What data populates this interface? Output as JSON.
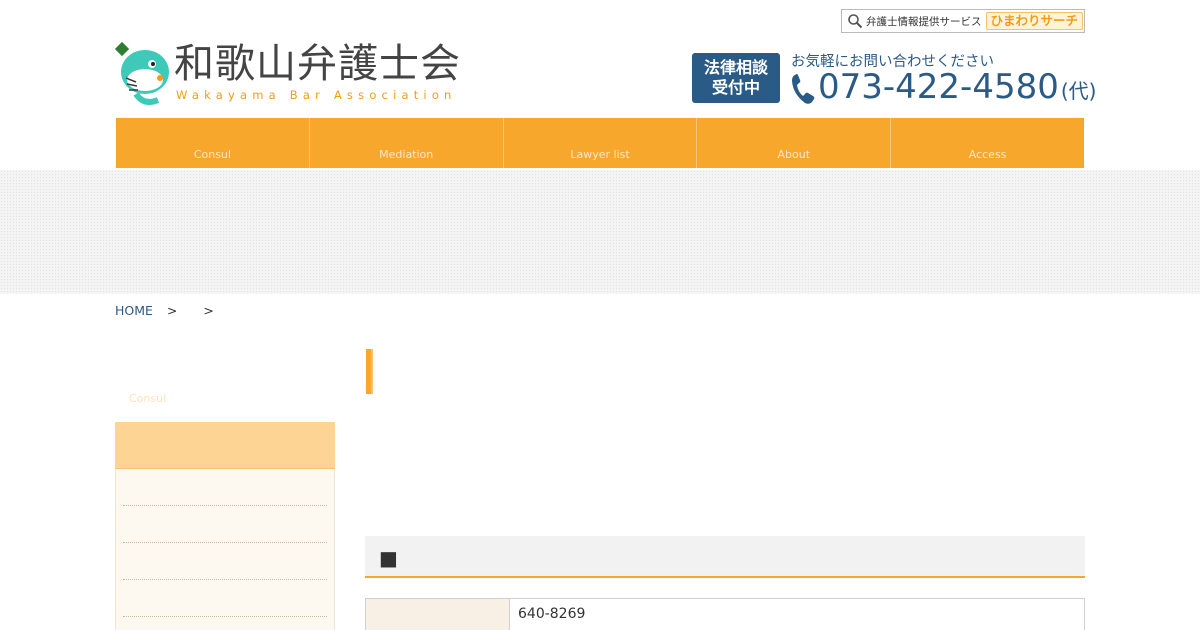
{
  "header": {
    "logo_jp": "和歌山弁護士会",
    "logo_en": "Wakayama Bar Association",
    "service_label": "弁護士情報提供サービス",
    "service_brand": "ひまわりサーチ",
    "consult_badge_line1": "法律相談",
    "consult_badge_line2": "受付中",
    "phone_lead": "お気軽にお問い合わせください",
    "phone_number": "073-422-4580",
    "phone_suffix": "(代)"
  },
  "nav": {
    "items": [
      {
        "label": "Consul"
      },
      {
        "label": "Mediation"
      },
      {
        "label": "Lawyer list"
      },
      {
        "label": "About"
      },
      {
        "label": "Access"
      }
    ]
  },
  "breadcrumb": {
    "home": "HOME",
    "sep": ">"
  },
  "sidebar": {
    "heading": "Consul"
  },
  "main": {
    "section_marker": "■",
    "table_rows": [
      {
        "value": "640-8269"
      }
    ]
  },
  "colors": {
    "accent": "#f8a72d",
    "brand_blue": "#2a5a86"
  }
}
